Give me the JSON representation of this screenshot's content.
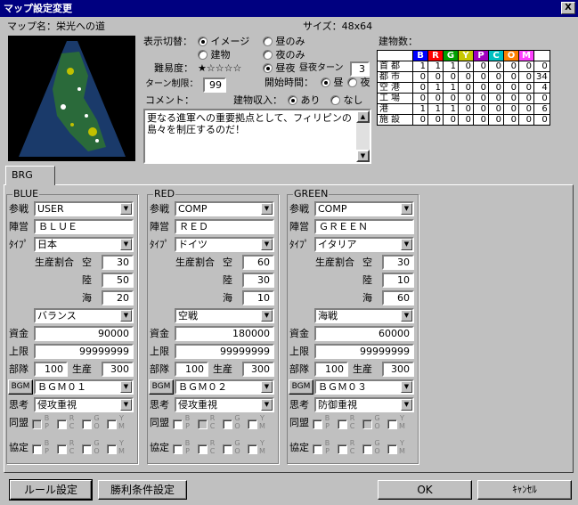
{
  "window": {
    "title": "マップ設定変更",
    "close": "X"
  },
  "map": {
    "name_label": "マップ名：栄光への道",
    "size_label": "サイズ：48x64"
  },
  "display": {
    "label": "表示切替：",
    "opt1": "イメージ",
    "opt2": "昼のみ",
    "opt3": "建物",
    "opt4": "夜のみ"
  },
  "difficulty": {
    "label": "難易度：",
    "stars": "★☆☆☆☆",
    "opt": "昼夜",
    "daynight_turn_label": "昼夜ターン",
    "daynight_turn": "3"
  },
  "turnlimit": {
    "label": "ターン制限：",
    "value": "99"
  },
  "starttime": {
    "label": "開始時間：",
    "day": "昼",
    "night": "夜"
  },
  "comment": {
    "label": "コメント：",
    "text": "更なる進軍への重要拠点として、フィリピンの島々を制圧するのだ！"
  },
  "income": {
    "label": "建物収入：",
    "yes": "あり",
    "no": "なし"
  },
  "buildings": {
    "label": "建物数：",
    "headers": [
      {
        "t": "B",
        "c": "#0000ff"
      },
      {
        "t": "R",
        "c": "#ff0000"
      },
      {
        "t": "G",
        "c": "#00a000"
      },
      {
        "t": "Y",
        "c": "#c8c800"
      },
      {
        "t": "P",
        "c": "#a000c0"
      },
      {
        "t": "C",
        "c": "#00c0c0"
      },
      {
        "t": "O",
        "c": "#ff8000"
      },
      {
        "t": "M",
        "c": "#ff40ff"
      },
      {
        "t": "",
        "c": "#ffffff"
      }
    ],
    "rows": [
      {
        "name": "首都",
        "v": [
          "1",
          "1",
          "1",
          "0",
          "0",
          "0",
          "0",
          "0",
          "0"
        ]
      },
      {
        "name": "都市",
        "v": [
          "0",
          "0",
          "0",
          "0",
          "0",
          "0",
          "0",
          "0",
          "34"
        ]
      },
      {
        "name": "空港",
        "v": [
          "0",
          "1",
          "1",
          "0",
          "0",
          "0",
          "0",
          "0",
          "4"
        ]
      },
      {
        "name": "工場",
        "v": [
          "0",
          "0",
          "0",
          "0",
          "0",
          "0",
          "0",
          "0",
          "0"
        ]
      },
      {
        "name": "港",
        "v": [
          "1",
          "1",
          "1",
          "0",
          "0",
          "0",
          "0",
          "0",
          "6"
        ]
      },
      {
        "name": "施設",
        "v": [
          "0",
          "0",
          "0",
          "0",
          "0",
          "0",
          "0",
          "0",
          "0"
        ]
      }
    ]
  },
  "tab": {
    "label": "BRG"
  },
  "labels": {
    "sansen": "参戦",
    "jinei": "陣営",
    "type": "ﾀｲﾌﾟ",
    "ratio": "生産割合",
    "air": "空",
    "land": "陸",
    "sea": "海",
    "funds": "資金",
    "limit": "上限",
    "units": "部隊",
    "prod": "生産",
    "bgm": "BGM",
    "think": "思考",
    "alliance": "同盟",
    "coop": "協定"
  },
  "allyletters": {
    "b": "B",
    "p": "P",
    "r": "R",
    "c": "C",
    "g": "G",
    "o": "O",
    "y": "Y",
    "m": "M"
  },
  "teams": [
    {
      "title": "BLUE",
      "player": "USER",
      "name": "ＢＬＵＥ",
      "type": "日本",
      "air": "30",
      "land": "50",
      "sea": "20",
      "strategy": "バランス",
      "funds": "90000",
      "limit": "99999999",
      "units": "100",
      "prod": "300",
      "bgm": "ＢＧＭ０１",
      "think": "侵攻重視"
    },
    {
      "title": "RED",
      "player": "COMP",
      "name": "ＲＥＤ",
      "type": "ドイツ",
      "air": "60",
      "land": "30",
      "sea": "10",
      "strategy": "空戦",
      "funds": "180000",
      "limit": "99999999",
      "units": "100",
      "prod": "300",
      "bgm": "ＢＧＭ０２",
      "think": "侵攻重視"
    },
    {
      "title": "GREEN",
      "player": "COMP",
      "name": "ＧＲＥＥＮ",
      "type": "イタリア",
      "air": "30",
      "land": "10",
      "sea": "60",
      "strategy": "海戦",
      "funds": "60000",
      "limit": "99999999",
      "units": "100",
      "prod": "300",
      "bgm": "ＢＧＭ０３",
      "think": "防御重視"
    }
  ],
  "buttons": {
    "rules": "ルール設定",
    "victory": "勝利条件設定",
    "ok": "OK",
    "cancel": "ｷｬﾝｾﾙ"
  }
}
